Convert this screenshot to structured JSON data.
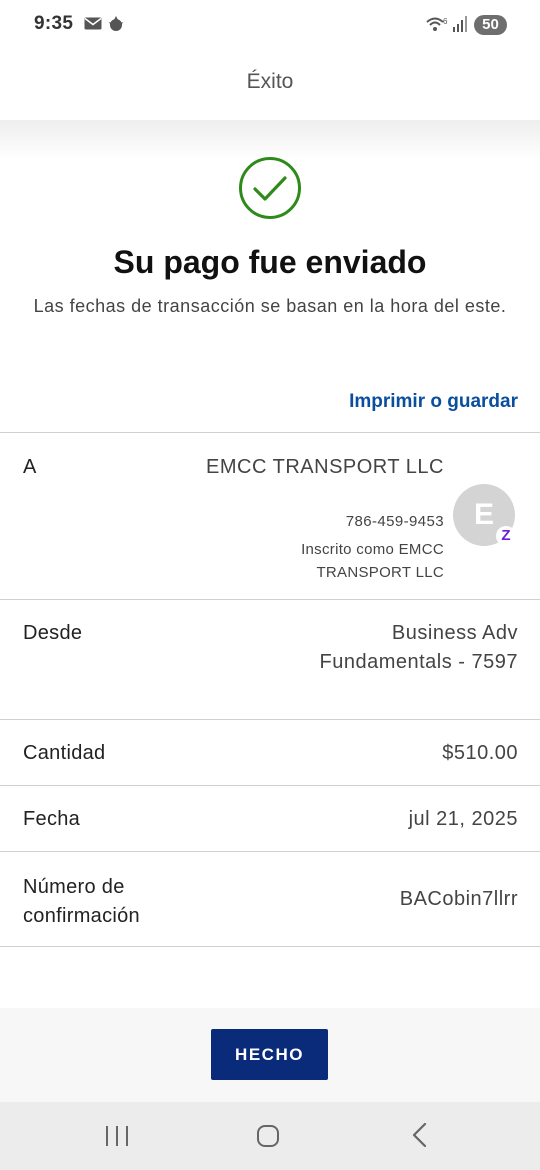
{
  "status_bar": {
    "time": "9:35",
    "battery": "50"
  },
  "header": {
    "title": "Éxito"
  },
  "confirmation": {
    "title": "Su pago fue enviado",
    "subtitle": "Las fechas de transacción se basan en la hora del este.",
    "print_label": "Imprimir o guardar"
  },
  "details": {
    "recipient": {
      "label": "A",
      "name": "EMCC TRANSPORT LLC",
      "phone": "786-459-9453",
      "enrolled_as": "Inscrito como EMCC TRANSPORT LLC",
      "avatar_letter": "E",
      "badge": "Z"
    },
    "from": {
      "label": "Desde",
      "value": "Business Adv Fundamentals - 7597"
    },
    "amount": {
      "label": "Cantidad",
      "value": "$510.00"
    },
    "date": {
      "label": "Fecha",
      "value": "jul 21, 2025"
    },
    "confirmation_number": {
      "label": "Número de confirmación",
      "value": "BACobin7llrr"
    }
  },
  "actions": {
    "done_label": "HECHO"
  },
  "colors": {
    "success": "#2e8b1a",
    "link": "#0a4f9e",
    "primary_button": "#0a2a7a",
    "zelle": "#6d1ed4"
  },
  "icons": [
    "mail-icon",
    "notification-icon",
    "wifi-icon",
    "signal-icon",
    "check-circle-icon",
    "zelle-icon",
    "nav-recents-icon",
    "nav-home-icon",
    "nav-back-icon"
  ]
}
